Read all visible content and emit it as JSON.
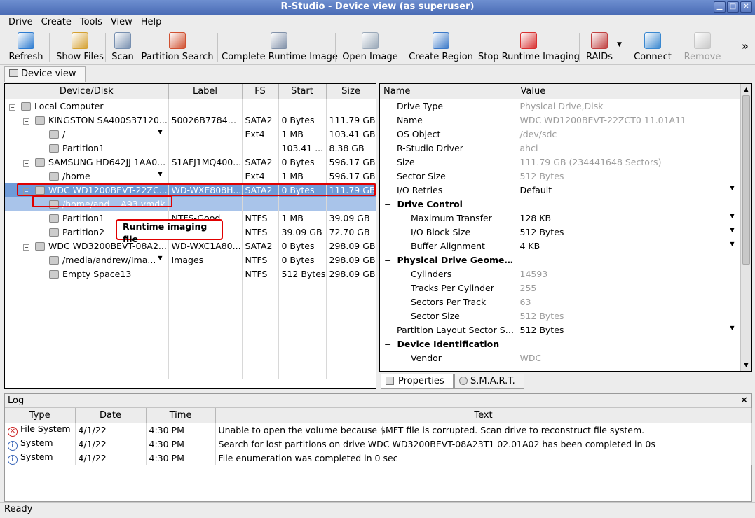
{
  "window": {
    "title": "R-Studio - Device view (as superuser)"
  },
  "menu": [
    "Drive",
    "Create",
    "Tools",
    "View",
    "Help"
  ],
  "toolbar": [
    {
      "label": "Refresh",
      "icon": "refresh-icon",
      "color": "#2a7ad0"
    },
    {
      "label": "Show Files",
      "icon": "show-files-icon",
      "color": "#d4a030"
    },
    {
      "label": "Scan",
      "icon": "scan-icon",
      "color": "#7890b0"
    },
    {
      "label": "Partition Search",
      "icon": "partition-search-icon",
      "color": "#d05030"
    },
    {
      "label": "Complete Runtime Image",
      "icon": "complete-runtime-image-icon",
      "color": "#8090a8"
    },
    {
      "label": "Open Image",
      "icon": "open-image-icon",
      "color": "#9aa8b8"
    },
    {
      "label": "Create Region",
      "icon": "create-region-icon",
      "color": "#3a78c8"
    },
    {
      "label": "Stop Runtime Imaging",
      "icon": "stop-runtime-imaging-icon",
      "color": "#d83030"
    },
    {
      "label": "RAIDs",
      "icon": "raids-icon",
      "color": "#c04040"
    },
    {
      "label": "Connect",
      "icon": "connect-icon",
      "color": "#3a88d0"
    },
    {
      "label": "Remove",
      "icon": "remove-icon",
      "color": "#c8c8c8"
    }
  ],
  "more": "»",
  "doc_tab": "Device view",
  "device_table": {
    "headers": [
      "Device/Disk",
      "Label",
      "FS",
      "Start",
      "Size"
    ],
    "rows": [
      {
        "name": "Local Computer",
        "label": "",
        "fs": "",
        "start": "",
        "size": "",
        "indent": 0
      },
      {
        "name": "KINGSTON SA400S37120...",
        "label": "50026B77843...",
        "fs": "SATA2",
        "start": "0 Bytes",
        "size": "111.79 GB",
        "indent": 1
      },
      {
        "name": "/",
        "label": "",
        "fs": "Ext4",
        "start": "1 MB",
        "size": "103.41 GB",
        "indent": 2,
        "dd": true
      },
      {
        "name": "Partition1",
        "label": "",
        "fs": "",
        "start": "103.41 ...",
        "size": "8.38 GB",
        "indent": 2
      },
      {
        "name": "SAMSUNG HD642JJ 1AA0...",
        "label": "S1AFJ1MQ400...",
        "fs": "SATA2",
        "start": "0 Bytes",
        "size": "596.17 GB",
        "indent": 1
      },
      {
        "name": "/home",
        "label": "",
        "fs": "Ext4",
        "start": "1 MB",
        "size": "596.17 GB",
        "indent": 2,
        "dd": true
      },
      {
        "name": "WDC WD1200BEVT-22ZC...",
        "label": "WD-WXE808H...",
        "fs": "SATA2",
        "start": "0 Bytes",
        "size": "111.79 GB",
        "indent": 1,
        "state": "sel"
      },
      {
        "name": "/home/and... A93.vmdk",
        "label": "",
        "fs": "",
        "start": "",
        "size": "",
        "indent": 2,
        "state": "subsel"
      },
      {
        "name": "Partition1",
        "label": "NTFS-Good",
        "fs": "NTFS",
        "start": "1 MB",
        "size": "39.09 GB",
        "indent": 2
      },
      {
        "name": "Partition2",
        "label": "",
        "fs": "NTFS",
        "start": "39.09 GB",
        "size": "72.70 GB",
        "indent": 2
      },
      {
        "name": "WDC WD3200BEVT-08A2...",
        "label": "WD-WXC1A80...",
        "fs": "SATA2",
        "start": "0 Bytes",
        "size": "298.09 GB",
        "indent": 1
      },
      {
        "name": "/media/andrew/Ima...",
        "label": "Images",
        "fs": "NTFS",
        "start": "0 Bytes",
        "size": "298.09 GB",
        "indent": 2,
        "dd": true
      },
      {
        "name": "Empty Space13",
        "label": "",
        "fs": "NTFS",
        "start": "512 Bytes",
        "size": "298.09 GB",
        "indent": 2
      }
    ]
  },
  "callout": "Runtime imaging file",
  "props_table": {
    "headers": [
      "Name",
      "Value"
    ],
    "rows": [
      {
        "name": "Drive Type",
        "value": "Physical Drive,Disk",
        "kind": "gray",
        "lvl": 1
      },
      {
        "name": "Name",
        "value": "WDC WD1200BEVT-22ZCT0 11.01A11",
        "kind": "gray",
        "lvl": 1
      },
      {
        "name": "OS Object",
        "value": "/dev/sdc",
        "kind": "gray",
        "lvl": 1
      },
      {
        "name": "R-Studio Driver",
        "value": "ahci",
        "kind": "gray",
        "lvl": 1
      },
      {
        "name": "Size",
        "value": "111.79 GB (234441648 Sectors)",
        "kind": "gray",
        "lvl": 1
      },
      {
        "name": "Sector Size",
        "value": "512 Bytes",
        "kind": "gray",
        "lvl": 1
      },
      {
        "name": "I/O Retries",
        "value": "Default",
        "kind": "dd",
        "lvl": 1
      },
      {
        "name": "Drive Control",
        "value": "",
        "kind": "grp",
        "lvl": 0
      },
      {
        "name": "Maximum Transfer",
        "value": "128 KB",
        "kind": "dd",
        "lvl": 2
      },
      {
        "name": "I/O Block Size",
        "value": "512 Bytes",
        "kind": "dd",
        "lvl": 2
      },
      {
        "name": "Buffer Alignment",
        "value": "4 KB",
        "kind": "dd",
        "lvl": 2
      },
      {
        "name": "Physical Drive Geometry",
        "value": "",
        "kind": "grp",
        "lvl": 0
      },
      {
        "name": "Cylinders",
        "value": "14593",
        "kind": "gray",
        "lvl": 2
      },
      {
        "name": "Tracks Per Cylinder",
        "value": "255",
        "kind": "gray",
        "lvl": 2
      },
      {
        "name": "Sectors Per Track",
        "value": "63",
        "kind": "gray",
        "lvl": 2
      },
      {
        "name": "Sector Size",
        "value": "512 Bytes",
        "kind": "gray",
        "lvl": 2
      },
      {
        "name": "Partition Layout Sector Size",
        "value": "512 Bytes",
        "kind": "dd",
        "lvl": 1
      },
      {
        "name": "Device Identification",
        "value": "",
        "kind": "grp",
        "lvl": 0
      },
      {
        "name": "Vendor",
        "value": "WDC",
        "kind": "gray",
        "lvl": 2
      }
    ]
  },
  "prop_tabs": [
    "Properties",
    "S.M.A.R.T."
  ],
  "log": {
    "title": "Log",
    "headers": [
      "Type",
      "Date",
      "Time",
      "Text"
    ],
    "rows": [
      {
        "type": "File System",
        "date": "4/1/22",
        "time": "4:30 PM",
        "text": "Unable to open the volume because $MFT file is corrupted. Scan drive to reconstruct file system.",
        "icon": "error"
      },
      {
        "type": "System",
        "date": "4/1/22",
        "time": "4:30 PM",
        "text": "Search for lost partitions on drive WDC WD3200BEVT-08A23T1 02.01A02 has been completed in 0s",
        "icon": "info"
      },
      {
        "type": "System",
        "date": "4/1/22",
        "time": "4:30 PM",
        "text": "File enumeration was completed in 0 sec",
        "icon": "info"
      }
    ]
  },
  "status": "Ready"
}
